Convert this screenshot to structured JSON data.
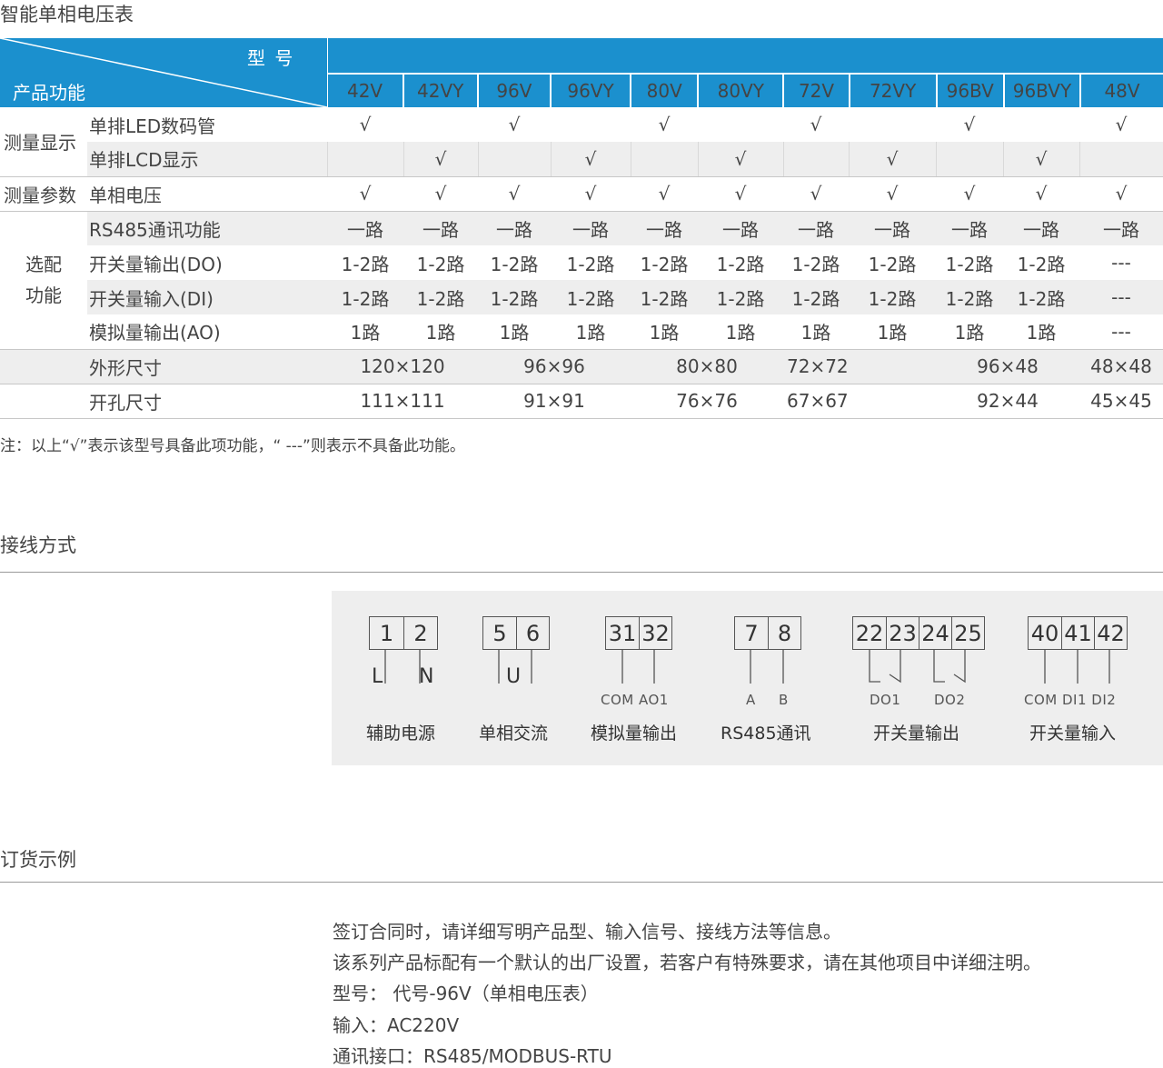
{
  "page_title": "智能单相电压表",
  "spec_table": {
    "header_model": "型 号",
    "header_func": "产品功能",
    "models": [
      "42V",
      "42VY",
      "96V",
      "96VY",
      "80V",
      "80VY",
      "72V",
      "72VY",
      "96BV",
      "96BVY",
      "48V"
    ],
    "group_display": "测量显示",
    "group_param": "测量参数",
    "group_optional_1": "选配",
    "group_optional_2": "功能",
    "rows": {
      "led": {
        "label": "单排LED数码管",
        "cells": [
          "√",
          "",
          "√",
          "",
          "√",
          "",
          "√",
          "",
          "√",
          "",
          "√"
        ]
      },
      "lcd": {
        "label": "单排LCD显示",
        "cells": [
          "",
          "√",
          "",
          "√",
          "",
          "√",
          "",
          "√",
          "",
          "√",
          ""
        ]
      },
      "volt": {
        "label": "单相电压",
        "cells": [
          "√",
          "√",
          "√",
          "√",
          "√",
          "√",
          "√",
          "√",
          "√",
          "√",
          "√"
        ]
      },
      "rs485": {
        "label": "RS485通讯功能",
        "cells": [
          "一路",
          "一路",
          "一路",
          "一路",
          "一路",
          "一路",
          "一路",
          "一路",
          "一路",
          "一路",
          "一路"
        ]
      },
      "do": {
        "label": "开关量输出(DO)",
        "cells": [
          "1-2路",
          "1-2路",
          "1-2路",
          "1-2路",
          "1-2路",
          "1-2路",
          "1-2路",
          "1-2路",
          "1-2路",
          "1-2路",
          "---"
        ]
      },
      "di": {
        "label": "开关量输入(DI)",
        "cells": [
          "1-2路",
          "1-2路",
          "1-2路",
          "1-2路",
          "1-2路",
          "1-2路",
          "1-2路",
          "1-2路",
          "1-2路",
          "1-2路",
          "---"
        ]
      },
      "ao": {
        "label": "模拟量输出(AO)",
        "cells": [
          "1路",
          "1路",
          "1路",
          "1路",
          "1路",
          "1路",
          "1路",
          "1路",
          "1路",
          "1路",
          "---"
        ]
      }
    },
    "size_label": "外形尺寸",
    "sizes": [
      "120×120",
      "96×96",
      "80×80",
      "72×72",
      "96×48",
      "48×48"
    ],
    "cutout_label": "开孔尺寸",
    "cutouts": [
      "111×111",
      "91×91",
      "76×76",
      "67×67",
      "92×44",
      "45×45"
    ]
  },
  "note": "注：以上“√”表示该型号具备此项功能，“ ---”则表示不具备此功能。",
  "wiring": {
    "title": "接线方式",
    "power": {
      "terms": [
        "1",
        "2"
      ],
      "labels": [
        "L",
        "N"
      ],
      "caption": "辅助电源"
    },
    "ac": {
      "terms": [
        "5",
        "6"
      ],
      "label": "U",
      "caption": "单相交流"
    },
    "ao": {
      "terms": [
        "31",
        "32"
      ],
      "sub": "COM AO1",
      "caption": "模拟量输出"
    },
    "rs485": {
      "terms": [
        "7",
        "8"
      ],
      "sub_a": "A",
      "sub_b": "B",
      "caption": "RS485通讯"
    },
    "do": {
      "terms": [
        "22",
        "23",
        "24",
        "25"
      ],
      "sub_1": "DO1",
      "sub_2": "DO2",
      "caption": "开关量输出"
    },
    "di": {
      "terms": [
        "40",
        "41",
        "42"
      ],
      "sub": "COM DI1 DI2",
      "caption": "开关量输入"
    }
  },
  "order": {
    "title": "订货示例",
    "lines": [
      "签订合同时，请详细写明产品型、输入信号、接线方法等信息。",
      "该系列产品标配有一个默认的出厂设置，若客户有特殊要求，请在其他项目中详细注明。",
      "型号：  代号-96V（单相电压表）",
      "输入：AC220V",
      "通讯接口：RS485/MODBUS-RTU"
    ]
  }
}
